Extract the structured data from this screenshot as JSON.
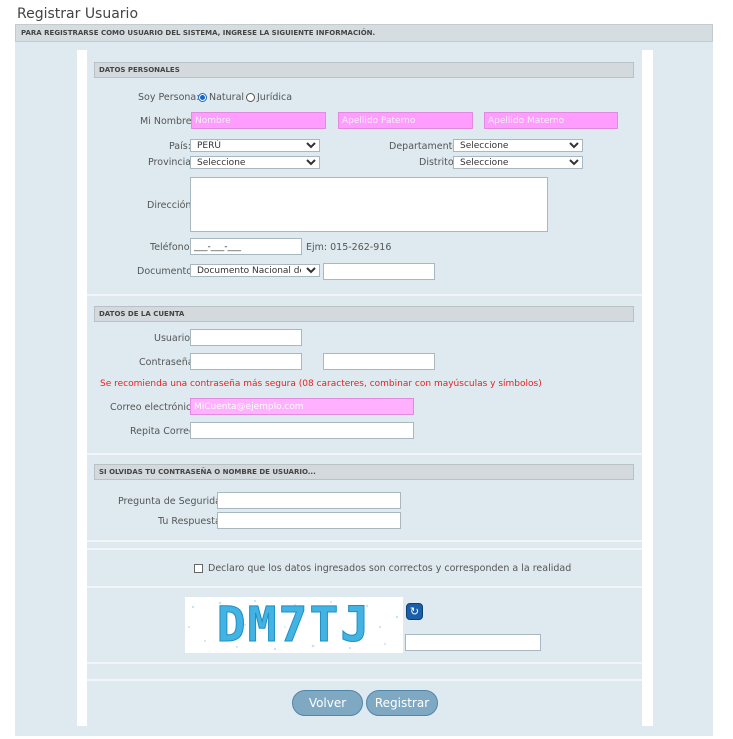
{
  "page": {
    "title": "Registrar Usuario",
    "subtitle": "PARA REGISTRARSE COMO USUARIO DEL SISTEMA, INGRESE LA SIGUIENTE INFORMACIÓN."
  },
  "personal": {
    "header": "DATOS PERSONALES",
    "persona_label": "Soy Persona:",
    "persona_options": [
      "Natural",
      "Jurídica"
    ],
    "persona_selected": "Natural",
    "nombre_label": "Mi Nombre:",
    "nombre_placeholder": "Nombre",
    "apellido_paterno_placeholder": "Apellido Paterno",
    "apellido_materno_placeholder": "Apellido Materno",
    "pais_label": "País:",
    "pais_value": "PERÚ",
    "departamento_label": "Departamento:",
    "departamento_value": "Seleccione",
    "provincia_label": "Provincia:",
    "provincia_value": "Seleccione",
    "distrito_label": "Distrito:",
    "distrito_value": "Seleccione",
    "direccion_label": "Dirección:",
    "telefono_label": "Teléfono:",
    "telefono_value": "___-___-___",
    "telefono_hint": "Ejm: 015-262-916",
    "documento_label": "Documento:",
    "documento_value": "Documento Nacional de Id"
  },
  "account": {
    "header": "DATOS DE LA CUENTA",
    "usuario_label": "Usuario:",
    "contrasena_label": "Contraseña:",
    "warning": "Se recomienda una contraseña más segura (08 caracteres, combinar con mayúsculas y símbolos)",
    "correo_label": "Correo electrónico:",
    "correo_placeholder": "MiCuenta@ejemplo.com",
    "repita_label": "Repita Correo:"
  },
  "recovery": {
    "header": "SI OLVIDAS TU CONTRASEÑA O NOMBRE DE USUARIO...",
    "pregunta_label": "Pregunta de Seguridad:",
    "respuesta_label": "Tu Respuesta:"
  },
  "declaration": {
    "text": "Declaro que los datos ingresados son correctos y corresponden a la realidad",
    "checked": false
  },
  "captcha": {
    "text": "DM7TJ",
    "refresh_icon": "refresh-icon"
  },
  "buttons": {
    "volver": "Volver",
    "registrar": "Registrar"
  },
  "colors": {
    "panel": "#dfeaf0",
    "highlight_field": "#ff9dff",
    "warning": "#e52222",
    "button": "#7fa9c3"
  }
}
